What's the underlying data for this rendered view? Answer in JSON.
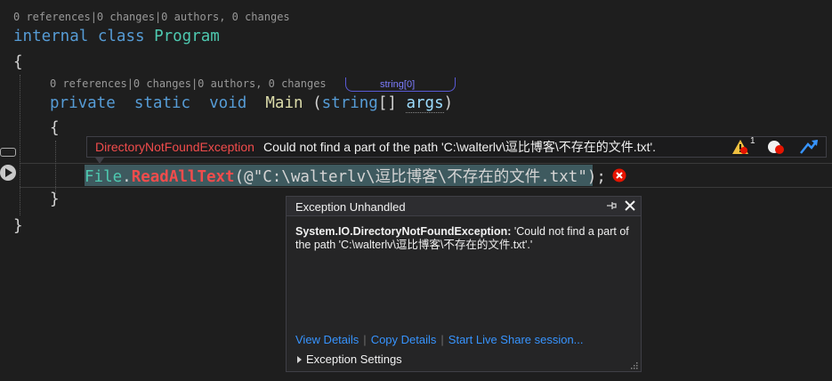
{
  "codelens": {
    "class_lens": "0 references|0 changes|0 authors, 0 changes",
    "method_lens": "0 references|0 changes|0 authors, 0 changes"
  },
  "code": {
    "kw_internal": "internal",
    "kw_class": "class",
    "class_name": "Program",
    "open_brace": "{",
    "close_brace": "}",
    "kw_private": "private",
    "kw_static": "static",
    "kw_void": "void",
    "method_name": "Main",
    "paren_open": "(",
    "param_type": "string",
    "brackets": "[]",
    "param_name": "args",
    "paren_close": ")",
    "call_class": "File",
    "dot": ".",
    "call_method": "ReadAllText",
    "call_open": "(@",
    "call_string": "\"C:\\walterlv\\逗比博客\\不存在的文件.txt\"",
    "call_close": ");"
  },
  "inline_hint": "string[0]",
  "exception_bar": {
    "type": "DirectoryNotFoundException",
    "message": "Could not find a part of the path 'C:\\walterlv\\逗比博客\\不存在的文件.txt'.",
    "warning_count": "1"
  },
  "popup": {
    "title": "Exception Unhandled",
    "exception_name": "System.IO.DirectoryNotFoundException:",
    "exception_message": "'Could not find a part of the path 'C:\\walterlv\\逗比博客\\不存在的文件.txt'.'",
    "links": [
      "View Details",
      "Copy Details",
      "Start Live Share session..."
    ],
    "settings_label": "Exception Settings"
  },
  "colors": {
    "error": "#f14c4c",
    "link": "#3794ff",
    "keyword": "#569cd6",
    "type": "#4ec9b0",
    "method": "#dcdcaa",
    "string": "#d69d85"
  }
}
